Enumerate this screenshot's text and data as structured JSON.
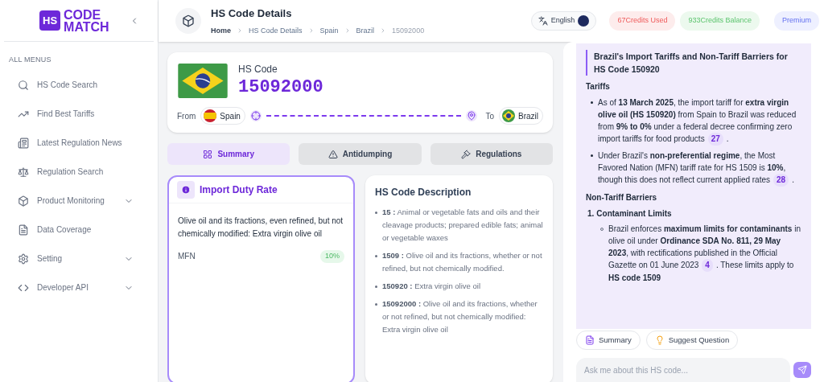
{
  "logo": {
    "mark": "HS",
    "line_1": "CODE",
    "line_2": "MATCH"
  },
  "sidebar": {
    "heading": "ALL MENUS",
    "items": [
      {
        "label": "HS Code Search",
        "expandable": false
      },
      {
        "label": "Find Best Tariffs",
        "expandable": false
      },
      {
        "label": "Latest Regulation News",
        "expandable": false
      },
      {
        "label": "Regulation Search",
        "expandable": false
      },
      {
        "label": "Product Monitoring",
        "expandable": true
      },
      {
        "label": "Data Coverage",
        "expandable": false
      },
      {
        "label": "Setting",
        "expandable": true
      },
      {
        "label": "Developer API",
        "expandable": true
      }
    ]
  },
  "header": {
    "title": "HS Code Details",
    "breadcrumbs": [
      "Home",
      "HS Code Details",
      "Spain",
      "Brazil",
      "15092000"
    ],
    "language": "English",
    "credits_used": "67Credits Used",
    "credits_balance": "933Credits Balance",
    "plan": "Premium"
  },
  "code_card": {
    "label": "HS Code",
    "code": "15092000",
    "from_label": "From",
    "from": "Spain",
    "to_label": "To",
    "to": "Brazil"
  },
  "tabs": [
    {
      "label": "Summary",
      "selected": true
    },
    {
      "label": "Antidumping",
      "selected": false
    },
    {
      "label": "Regulations",
      "selected": false
    }
  ],
  "duty_card": {
    "title": "Import Duty Rate",
    "description": "Olive oil and its fractions, even refined, but not chemically modified: Extra virgin olive oil",
    "rates": [
      {
        "name": "MFN",
        "value": "10%"
      }
    ]
  },
  "description_card": {
    "title": "HS Code Description",
    "items": [
      {
        "code": "15 :",
        "text": "Animal or vegetable fats and oils and their cleavage products; prepared edible fats; animal or vegetable waxes"
      },
      {
        "code": "1509 :",
        "text": "Olive oil and its fractions, whether or not refined, but not chemically modified."
      },
      {
        "code": "150920 :",
        "text": "Extra virgin olive oil"
      },
      {
        "code": "15092000 :",
        "text": "Olive oil and its fractions, whether or not refined, but not chemically modified: Extra virgin olive oil"
      }
    ]
  },
  "chat": {
    "title": "Brazil's Import Tariffs and Non-Tariff Barriers for HS Code 150920",
    "sections": [
      {
        "heading": "Tariffs",
        "kind": "bullets",
        "items": [
          {
            "text": "As of **13 March 2025**, the import tariff for **extra virgin olive oil (HS 150920)** from Spain to Brazil was reduced from **9% to 0%** under a federal decree confirming zero import tariffs for food products",
            "cite": "27",
            "tail": "."
          },
          {
            "text": "Under Brazil's **non-preferential regime**, the Most Favored Nation (MFN) tariff rate for HS 1509 is **10%**, though this does not reflect current applied rates",
            "cite": "28",
            "tail": "."
          }
        ]
      },
      {
        "heading": "Non-Tariff Barriers",
        "kind": "numbered",
        "items": [
          {
            "number": "1.",
            "title": "Contaminant Limits",
            "bullets": [
              {
                "text": "Brazil enforces **maximum limits for contaminants** in olive oil under **Ordinance SDA No. 811, 29 May 2023**, with rectifications published in the Official Gazette on 01 June 2023",
                "cite": "4",
                "tail": ". These limits apply to **HS code 1509**"
              }
            ]
          }
        ]
      }
    ],
    "actions": [
      "Summary",
      "Suggest Question"
    ],
    "input_placeholder": "Ask me about this HS code..."
  }
}
